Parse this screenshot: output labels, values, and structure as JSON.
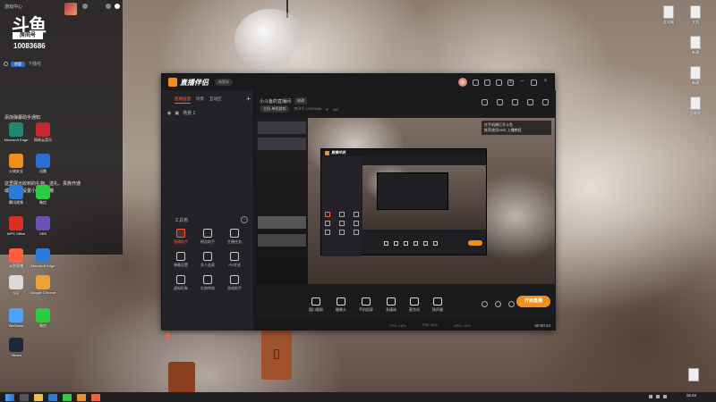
{
  "side_panel": {
    "header_small": "游戏中心",
    "logo": "斗鱼",
    "logo_sub": "房间号",
    "room_id": "10083686",
    "chat_badge": "房管",
    "chat_text": "下播啦",
    "tip_lines": [
      "添加弹幕助手通知",
      "这里展示收到的礼物、送礼、贵族开通",
      "或事件可设置小礼物屏蔽"
    ]
  },
  "desktop_left_icons": [
    {
      "label": "Microsoft Edge",
      "color": "#1f8a70"
    },
    {
      "label": "网易云音乐",
      "color": "#c8282d"
    },
    {
      "label": "火绒安全",
      "color": "#f08f1c"
    },
    {
      "label": "迅雷",
      "color": "#2b6fd6"
    },
    {
      "label": "腾讯视频",
      "color": "#2b7bd9"
    },
    {
      "label": "微信",
      "color": "#2ecc40"
    },
    {
      "label": "WPS Office",
      "color": "#d93025"
    },
    {
      "label": "OBS",
      "color": "#6b4fbb"
    },
    {
      "label": "斗鱼直播",
      "color": "#ff5e3a"
    },
    {
      "label": "Microsoft Edge",
      "color": "#2b7bd9"
    },
    {
      "label": "QQ",
      "color": "#d9d9d9"
    },
    {
      "label": "Google Chrome",
      "color": "#e8a33b"
    },
    {
      "label": "WeGame",
      "color": "#4aa3ff"
    },
    {
      "label": "微信",
      "color": "#2ecc40"
    },
    {
      "label": "Steam",
      "color": "#1b2838"
    }
  ],
  "desktop_right_icons": [
    {
      "label": "此电脑"
    },
    {
      "label": "文档"
    },
    {
      "label": "新建"
    },
    {
      "label": "新建"
    },
    {
      "label": "回收站"
    }
  ],
  "app": {
    "brand": "直播伴侣",
    "brand_badge": "新版本",
    "tabs": [
      "直播画面",
      "场景",
      "互动区"
    ],
    "scene_label": "场景 1",
    "toolbox_title": "工具箱",
    "tools": [
      {
        "label": "直播助手",
        "accent": true
      },
      {
        "label": "粉丝助手",
        "accent": false
      },
      {
        "label": "主播任务",
        "accent": false
      },
      {
        "label": "弹幕设置",
        "accent": false
      },
      {
        "label": "多人连麦",
        "accent": false
      },
      {
        "label": "PK对战",
        "accent": false
      },
      {
        "label": "虚拟形象",
        "accent": false
      },
      {
        "label": "礼物特效",
        "accent": false
      },
      {
        "label": "游戏助手",
        "accent": false
      }
    ],
    "notice": "如何把手机游戏投屏到电脑",
    "stream_title": "小斗鱼的直播间",
    "edit_label": "修改",
    "category": "主机-单机游戏",
    "info_text": "房间号 10083686",
    "fans_count": "300",
    "overlay_lines": [
      "在手机端打开斗鱼",
      "推荐使用OBS 上播教程"
    ],
    "controls": [
      "窗口截取",
      "摄像头",
      "手机投屏",
      "多媒体",
      "麦克风",
      "扬声器"
    ],
    "golive": "开始直播",
    "status": [
      "CPU: 18%",
      "内存 54%",
      "GPU: 12%"
    ],
    "time_elapsed": "00:00:43"
  },
  "taskbar": {
    "time": "15:42"
  }
}
